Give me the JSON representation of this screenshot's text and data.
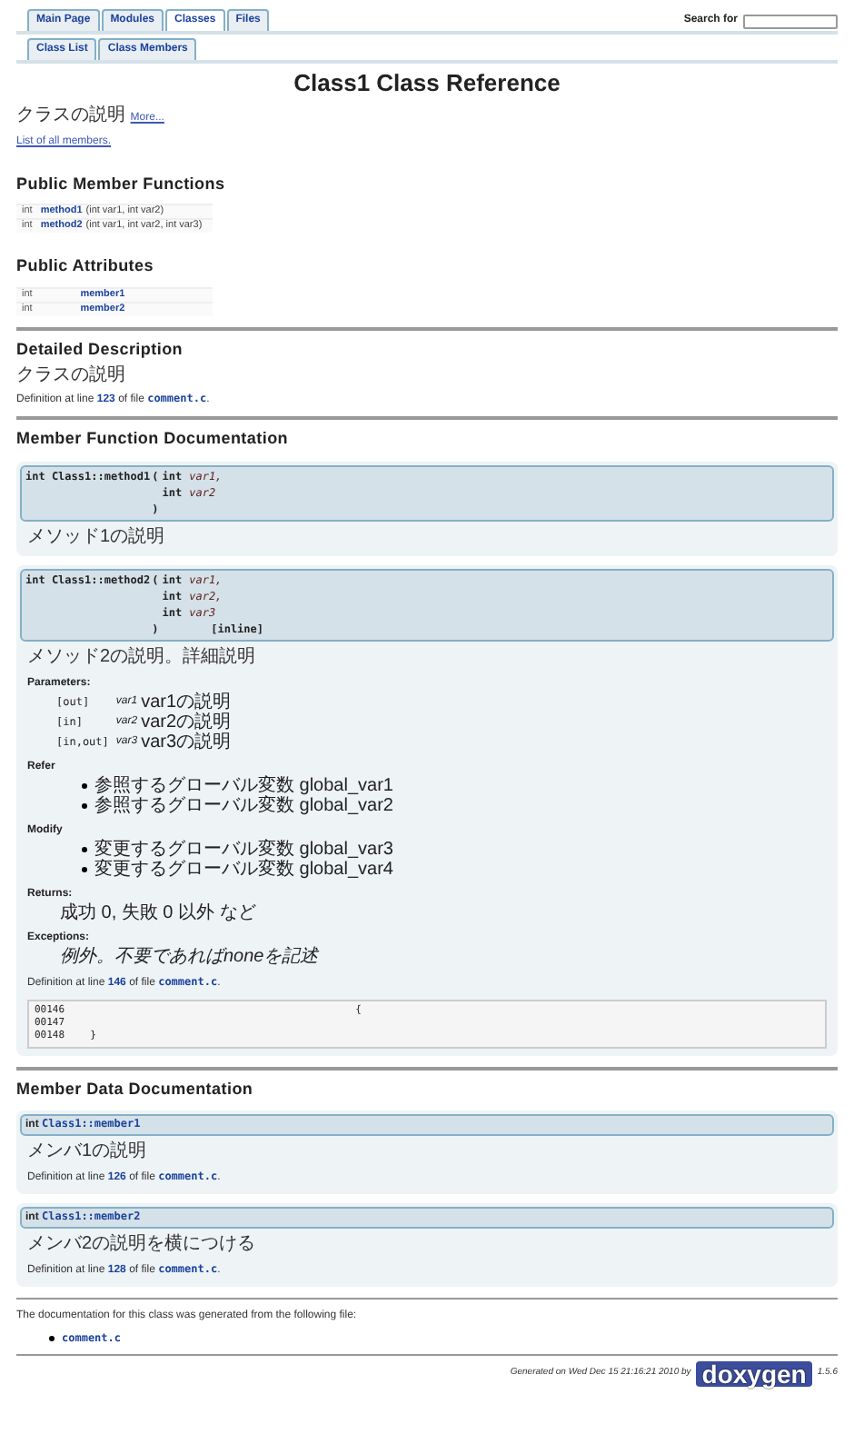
{
  "tabs": [
    {
      "label": "Main Page",
      "selected": false
    },
    {
      "label": "Modules",
      "selected": false
    },
    {
      "label": "Classes",
      "selected": true
    },
    {
      "label": "Files",
      "selected": false
    }
  ],
  "subtabs": [
    {
      "label": "Class List",
      "selected": false
    },
    {
      "label": "Class Members",
      "selected": false
    }
  ],
  "search": {
    "label": "Search for"
  },
  "title": "Class1 Class Reference",
  "brief": {
    "text": "クラスの説明",
    "link": "More..."
  },
  "all_members": "List of all members.",
  "summary": [
    {
      "heading": "Public Member Functions",
      "rows": [
        {
          "type": "int",
          "name": "method1",
          "args": "(int var1, int var2)"
        },
        {
          "type": "int",
          "name": "method2",
          "args": "(int var1, int var2, int var3)"
        }
      ]
    },
    {
      "heading": "Public Attributes",
      "rows": [
        {
          "type": "int",
          "name": "member1"
        },
        {
          "type": "int",
          "name": "member2"
        }
      ]
    }
  ],
  "detailed": {
    "heading": "Detailed Description",
    "text": "クラスの説明",
    "definition": {
      "prefix": "Definition at line",
      "line": "123",
      "middle": "of file",
      "file": "comment.c",
      "suffix": "."
    }
  },
  "functions": {
    "heading": "Member Function Documentation",
    "items": [
      {
        "ret": "int",
        "scope": "Class1::",
        "name": "method1",
        "open": "(",
        "close": ")",
        "params": [
          {
            "type": "int",
            "name": "var1,"
          },
          {
            "type": "int",
            "name": "var2"
          }
        ],
        "body": [
          {
            "kind": "para",
            "text": "メソッド1の説明"
          }
        ]
      },
      {
        "ret": "int",
        "scope": "Class1::",
        "name": "method2",
        "open": "(",
        "close": ")",
        "suffix": "[inline]",
        "params": [
          {
            "type": "int",
            "name": "var1,"
          },
          {
            "type": "int",
            "name": "var2,"
          },
          {
            "type": "int",
            "name": "var3"
          }
        ],
        "body": [
          {
            "kind": "para",
            "text": "メソッド2の説明。詳細説明"
          },
          {
            "kind": "params",
            "heading": "Parameters:",
            "items": [
              {
                "dir": "[out]",
                "name": "var1",
                "desc": "var1の説明"
              },
              {
                "dir": "[in]",
                "name": "var2",
                "desc": "var2の説明"
              },
              {
                "dir": "[in,out]",
                "name": "var3",
                "desc": "var3の説明"
              }
            ]
          },
          {
            "kind": "list",
            "heading": "Refer",
            "items": [
              "参照するグローバル変数 global_var1",
              "参照するグローバル変数 global_var2"
            ]
          },
          {
            "kind": "list",
            "heading": "Modify",
            "items": [
              "変更するグローバル変数 global_var3",
              "変更するグローバル変数 global_var4"
            ]
          },
          {
            "kind": "note",
            "heading": "Returns:",
            "text": "成功 0, 失敗 0 以外 など",
            "italic": false
          },
          {
            "kind": "note",
            "heading": "Exceptions:",
            "text": "例外。不要であればnoneを記述",
            "italic": true
          },
          {
            "kind": "definition",
            "prefix": "Definition at line",
            "line": "146",
            "middle": "of file",
            "file": "comment.c",
            "suffix": "."
          },
          {
            "kind": "code",
            "lines": [
              {
                "num": "00146",
                "text": "{",
                "indent": true
              },
              {
                "num": "00147"
              },
              {
                "num": "00148",
                "text": "}",
                "indent": false
              }
            ]
          }
        ]
      }
    ]
  },
  "data": {
    "heading": "Member Data Documentation",
    "items": [
      {
        "ret": "int",
        "scope": "Class1::",
        "name": "member1",
        "text": "メンバ1の説明",
        "definition": {
          "prefix": "Definition at line",
          "line": "126",
          "middle": "of file",
          "file": "comment.c",
          "suffix": "."
        }
      },
      {
        "ret": "int",
        "scope": "Class1::",
        "name": "member2",
        "text": "メンバ2の説明を横につける",
        "definition": {
          "prefix": "Definition at line",
          "line": "128",
          "middle": "of file",
          "file": "comment.c",
          "suffix": "."
        }
      }
    ]
  },
  "footer": {
    "text": "The documentation for this class was generated from the following file:",
    "files": [
      "comment.c"
    ],
    "generated": "Generated on Wed Dec 15 21:16:21 2010 by",
    "logo": "doxygen",
    "version": "1.5.6"
  }
}
